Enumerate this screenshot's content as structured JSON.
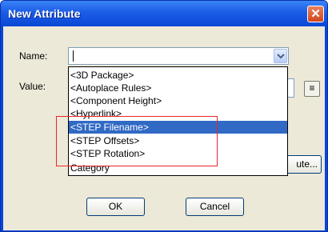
{
  "dialog": {
    "title": "New Attribute",
    "close_glyph": "✕",
    "name_label": "Name:",
    "value_label": "Value:",
    "name_value": "",
    "ellipsis_label": "≡",
    "partial_button_label": "ute...",
    "ok_label": "OK",
    "cancel_label": "Cancel"
  },
  "dropdown": {
    "items": [
      "<3D Package>",
      "<Autoplace Rules>",
      "<Component Height>",
      "<Hyperlink>",
      "<STEP Filename>",
      "<STEP Offsets>",
      "<STEP Rotation>",
      "Category"
    ],
    "selected_index": 4
  },
  "colors": {
    "selection": "#316ac5",
    "highlight_box": "#e8262b",
    "titlebar": "#0a48d6"
  }
}
